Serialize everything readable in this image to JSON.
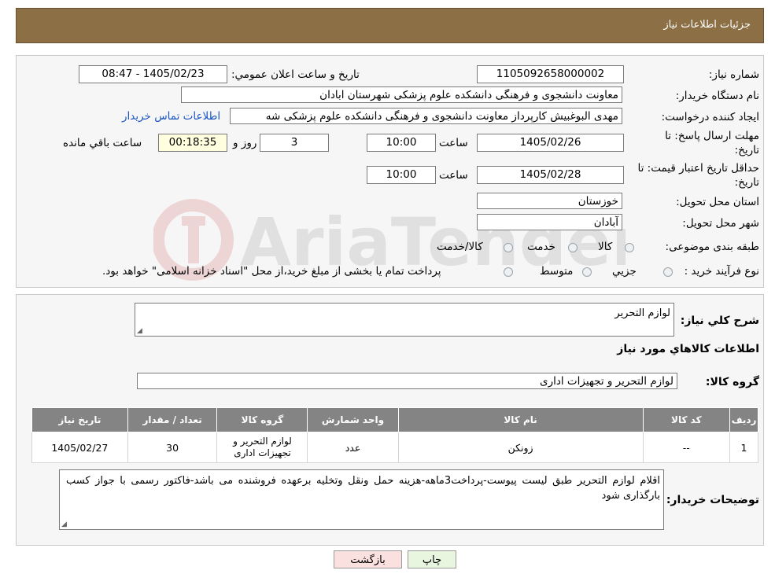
{
  "header": {
    "title": "جزئیات اطلاعات نیاز"
  },
  "form": {
    "need_number_label": "شماره نیاز:",
    "need_number": "1105092658000002",
    "announce_label": "تاريخ و ساعت اعلان عمومي:",
    "announce_value": "1405/02/23 - 08:47",
    "buyer_org_label": "نام دستگاه خريدار:",
    "buyer_org": "معاونت دانشجوی و فرهنگی دانشکده علوم پزشکی شهرستان ابادان",
    "creator_label": "ايجاد کننده درخواست:",
    "creator": "مهدی البوغبیش کارپرداز معاونت دانشجوی و فرهنگی دانشکده علوم پزشکی شه",
    "contact_link": "اطلاعات تماس خريدار",
    "deadline_label_1": "مهلت ارسال پاسخ: تا",
    "deadline_label_2": "تاريخ:",
    "deadline_date": "1405/02/26",
    "time_label": "ساعت",
    "deadline_time": "10:00",
    "days_value": "3",
    "days_label": "روز و",
    "remaining_time": "00:18:35",
    "remaining_label": "ساعت باقي مانده",
    "validity_label_1": "حداقل تاريخ اعتبار قيمت: تا",
    "validity_label_2": "تاريخ:",
    "validity_date": "1405/02/28",
    "validity_time_label": "ساعت",
    "validity_time": "10:00",
    "province_label": "استان محل تحويل:",
    "province": "خوزستان",
    "city_label": "شهر محل تحويل:",
    "city": "آبادان",
    "category_label": "طبقه بندی موضوعی:",
    "category_options": [
      "کالا",
      "خدمت",
      "کالا/خدمت"
    ],
    "process_label": "نوع فرآيند خريد :",
    "process_options": [
      "جزيي",
      "متوسط"
    ],
    "process_note": "پرداخت تمام يا بخشی از مبلغ خريد،از محل \"اسناد خزانه اسلامی\" خواهد بود."
  },
  "details": {
    "summary_label": "شرح کلي نياز:",
    "summary": "لوازم التحریر",
    "goods_info_title": "اطلاعات کالاهاي مورد نياز",
    "goods_group_label": "گروه کالا:",
    "goods_group": "لوازم التحرير و تجهيزات اداری",
    "table": {
      "headers": [
        "رديف",
        "کد کالا",
        "نام کالا",
        "واحد شمارش",
        "گروه کالا",
        "تعداد / مقدار",
        "تاريخ نياز"
      ],
      "rows": [
        [
          "1",
          "--",
          "زونکن",
          "عدد",
          "لوازم التحرير و تجهيزات اداری",
          "30",
          "1405/02/27"
        ]
      ]
    },
    "buyer_notes_label": "توضيحات خريدار:",
    "buyer_notes": "اقلام لوازم التحریر طبق لیست پیوست-پرداخت3ماهه-هزینه حمل ونقل وتخلیه برعهده فروشنده می باشد-فاکتور رسمی با جواز کسب بارگذاری شود"
  },
  "buttons": {
    "print": "چاپ",
    "back": "بازگشت"
  },
  "watermark": {
    "text": "AriaTender.neT"
  },
  "colors": {
    "header_bg": "#8c6f45",
    "table_header_bg": "#848484",
    "link": "#1a55c4"
  }
}
